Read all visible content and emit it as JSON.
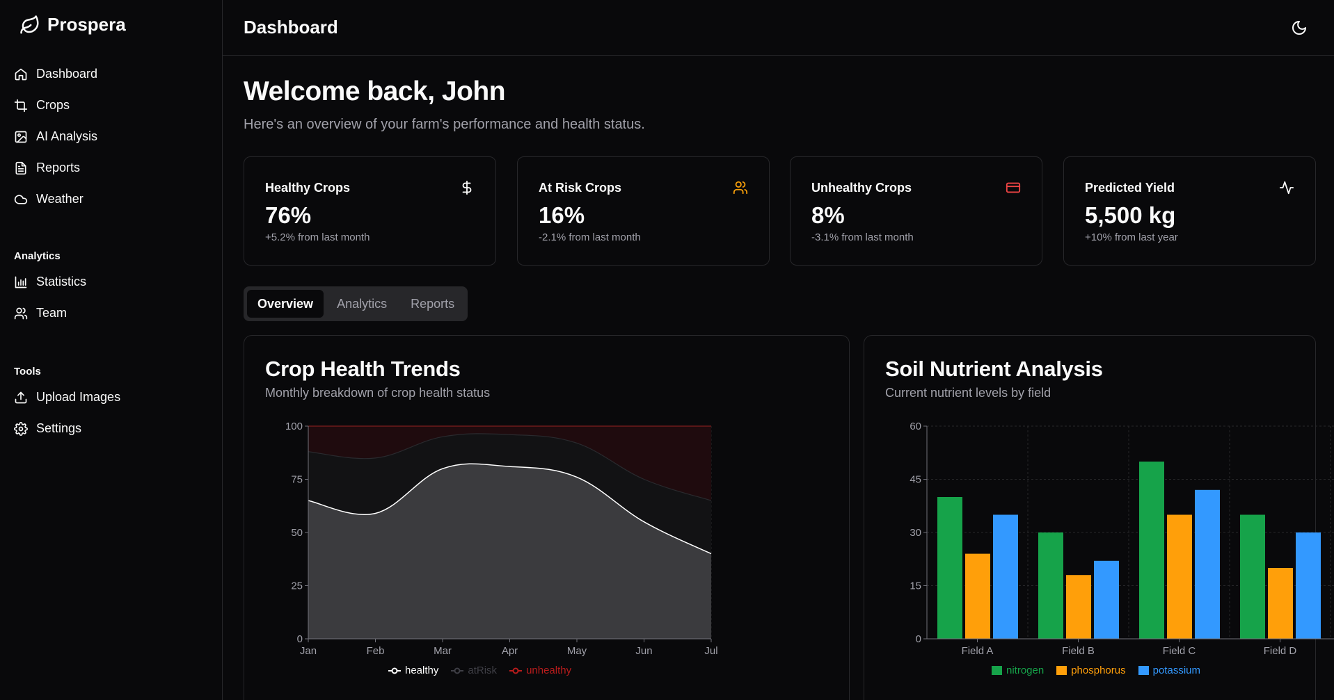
{
  "app": {
    "name": "Prospera"
  },
  "sidebar": {
    "main_items": [
      {
        "label": "Dashboard",
        "icon": "home-icon"
      },
      {
        "label": "Crops",
        "icon": "crop-icon"
      },
      {
        "label": "AI Analysis",
        "icon": "image-icon"
      },
      {
        "label": "Reports",
        "icon": "file-text-icon"
      },
      {
        "label": "Weather",
        "icon": "cloud-icon"
      }
    ],
    "analytics_label": "Analytics",
    "analytics_items": [
      {
        "label": "Statistics",
        "icon": "bar-chart-icon"
      },
      {
        "label": "Team",
        "icon": "users-icon"
      }
    ],
    "tools_label": "Tools",
    "tools_items": [
      {
        "label": "Upload Images",
        "icon": "upload-icon"
      },
      {
        "label": "Settings",
        "icon": "gear-icon"
      }
    ]
  },
  "header": {
    "title": "Dashboard",
    "theme_icon": "moon-icon"
  },
  "welcome": {
    "title": "Welcome back, John",
    "subtitle": "Here's an overview of your farm's performance and health status."
  },
  "stats": [
    {
      "title": "Healthy Crops",
      "value": "76%",
      "change": "+5.2% from last month",
      "icon": "dollar-icon",
      "icon_color": "#fafafa"
    },
    {
      "title": "At Risk Crops",
      "value": "16%",
      "change": "-2.1% from last month",
      "icon": "users-icon",
      "icon_color": "#f59e0b"
    },
    {
      "title": "Unhealthy Crops",
      "value": "8%",
      "change": "-3.1% from last month",
      "icon": "credit-card-icon",
      "icon_color": "#ef4444"
    },
    {
      "title": "Predicted Yield",
      "value": "5,500 kg",
      "change": "+10% from last year",
      "icon": "activity-icon",
      "icon_color": "#fafafa"
    }
  ],
  "tabs": [
    "Overview",
    "Analytics",
    "Reports"
  ],
  "active_tab": "Overview",
  "chart_data": [
    {
      "type": "area",
      "title": "Crop Health Trends",
      "subtitle": "Monthly breakdown of crop health status",
      "categories": [
        "Jan",
        "Feb",
        "Mar",
        "Apr",
        "May",
        "Jun",
        "Jul"
      ],
      "stacked": true,
      "ylim": [
        0,
        100
      ],
      "yticks": [
        0,
        25,
        50,
        75,
        100
      ],
      "series": [
        {
          "name": "healthy",
          "values": [
            65,
            59,
            80,
            81,
            76,
            55,
            40
          ],
          "color": "#ffffff"
        },
        {
          "name": "atRisk",
          "values": [
            23,
            26,
            15,
            15,
            16,
            20,
            25
          ],
          "color": "#3f3f46"
        },
        {
          "name": "unhealthy",
          "values": [
            12,
            15,
            5,
            4,
            8,
            25,
            35
          ],
          "color": "#7f1d1d"
        }
      ],
      "legend": "bottom",
      "grid": true
    },
    {
      "type": "bar",
      "title": "Soil Nutrient Analysis",
      "subtitle": "Current nutrient levels by field",
      "categories": [
        "Field A",
        "Field B",
        "Field C",
        "Field D"
      ],
      "ylim": [
        0,
        60
      ],
      "yticks": [
        0,
        15,
        30,
        45,
        60
      ],
      "series": [
        {
          "name": "nitrogen",
          "values": [
            40,
            30,
            50,
            35
          ],
          "color": "#16a34a"
        },
        {
          "name": "phosphorus",
          "values": [
            24,
            18,
            35,
            20
          ],
          "color": "#ff9f0a"
        },
        {
          "name": "potassium",
          "values": [
            35,
            22,
            42,
            30
          ],
          "color": "#3399ff"
        }
      ],
      "legend": "bottom",
      "grid": true
    }
  ]
}
